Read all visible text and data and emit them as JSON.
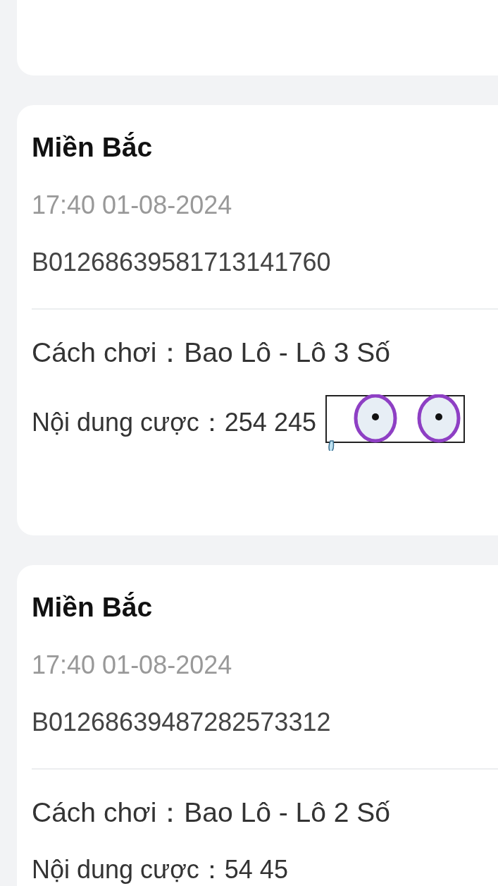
{
  "bets": [
    {
      "region": "Miền Bắc",
      "time": "17:40 01-08-2024",
      "code": "B01268639581713141760",
      "play_label": "Cách chơi：",
      "play_type": "Bao Lô - Lô 3 Số",
      "content_label": "Nội dung cược：",
      "content": "254 245",
      "sticker": true
    },
    {
      "region": "Miền Bắc",
      "time": "17:40 01-08-2024",
      "code": "B01268639487282573312",
      "play_label": "Cách chơi：",
      "play_type": "Bao Lô - Lô 2 Số",
      "content_label": "Nội dung cược：",
      "content": "54 45",
      "sticker": false
    }
  ]
}
